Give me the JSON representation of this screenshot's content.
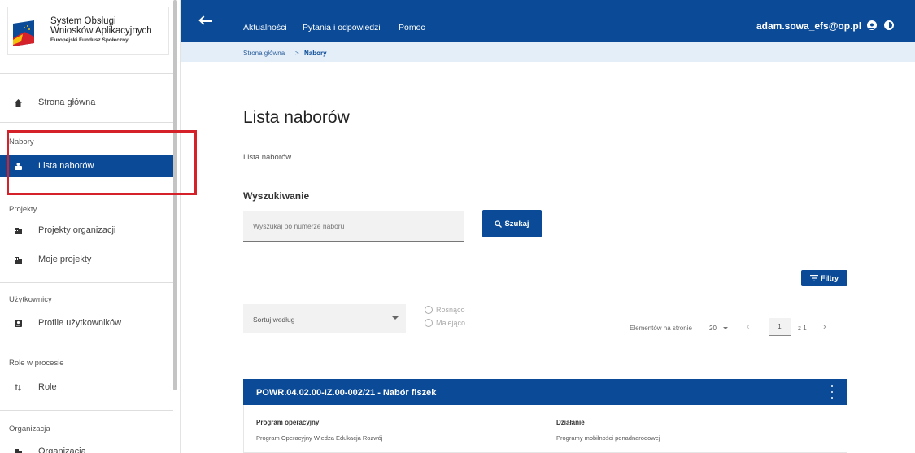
{
  "app": {
    "logo_title_line1": "System Obsługi",
    "logo_title_line2": "Wniosków Aplikacyjnych",
    "logo_subtitle": "Europejski Fundusz Społeczny"
  },
  "topbar": {
    "nav": [
      "Aktualności",
      "Pytania i odpowiedzi",
      "Pomoc"
    ],
    "user_email": "adam.sowa_efs@op.pl"
  },
  "breadcrumb": {
    "home": "Strona główna",
    "separator": ">",
    "current": "Nabory"
  },
  "sidebar": {
    "home_label": "Strona główna",
    "sections": [
      {
        "header": "Nabory",
        "items": [
          {
            "label": "Lista naborów",
            "active": true
          }
        ]
      },
      {
        "header": "Projekty",
        "items": [
          {
            "label": "Projekty organizacji"
          },
          {
            "label": "Moje projekty"
          }
        ]
      },
      {
        "header": "Użytkownicy",
        "items": [
          {
            "label": "Profile użytkowników"
          }
        ]
      },
      {
        "header": "Role w procesie",
        "items": [
          {
            "label": "Role"
          }
        ]
      },
      {
        "header": "Organizacja",
        "items": [
          {
            "label": "Organizacja"
          }
        ]
      }
    ]
  },
  "main": {
    "title": "Lista naborów",
    "subtitle": "Lista naborów",
    "search_heading": "Wyszukiwanie",
    "search_placeholder": "Wyszukaj po numerze naboru",
    "search_button": "Szukaj",
    "filter_button": "Filtry",
    "sort_label": "Sortuj według",
    "sort_asc": "Rosnąco",
    "sort_desc": "Malejąco",
    "per_page_label": "Elementów na stronie",
    "per_page_value": "20",
    "page_current": "1",
    "page_total": "z 1"
  },
  "card": {
    "title": "POWR.04.02.00-IZ.00-002/21 - Nabór fiszek",
    "fields": [
      {
        "label": "Program operacyjny",
        "value": "Program Operacyjny Wiedza Edukacja Rozwój"
      },
      {
        "label": "Działanie",
        "value": "Programy mobilności ponadnarodowej"
      }
    ]
  },
  "colors": {
    "primary": "#0a4a96",
    "breadcrumb_bg": "#e3eef9",
    "highlight": "#d4212a"
  }
}
